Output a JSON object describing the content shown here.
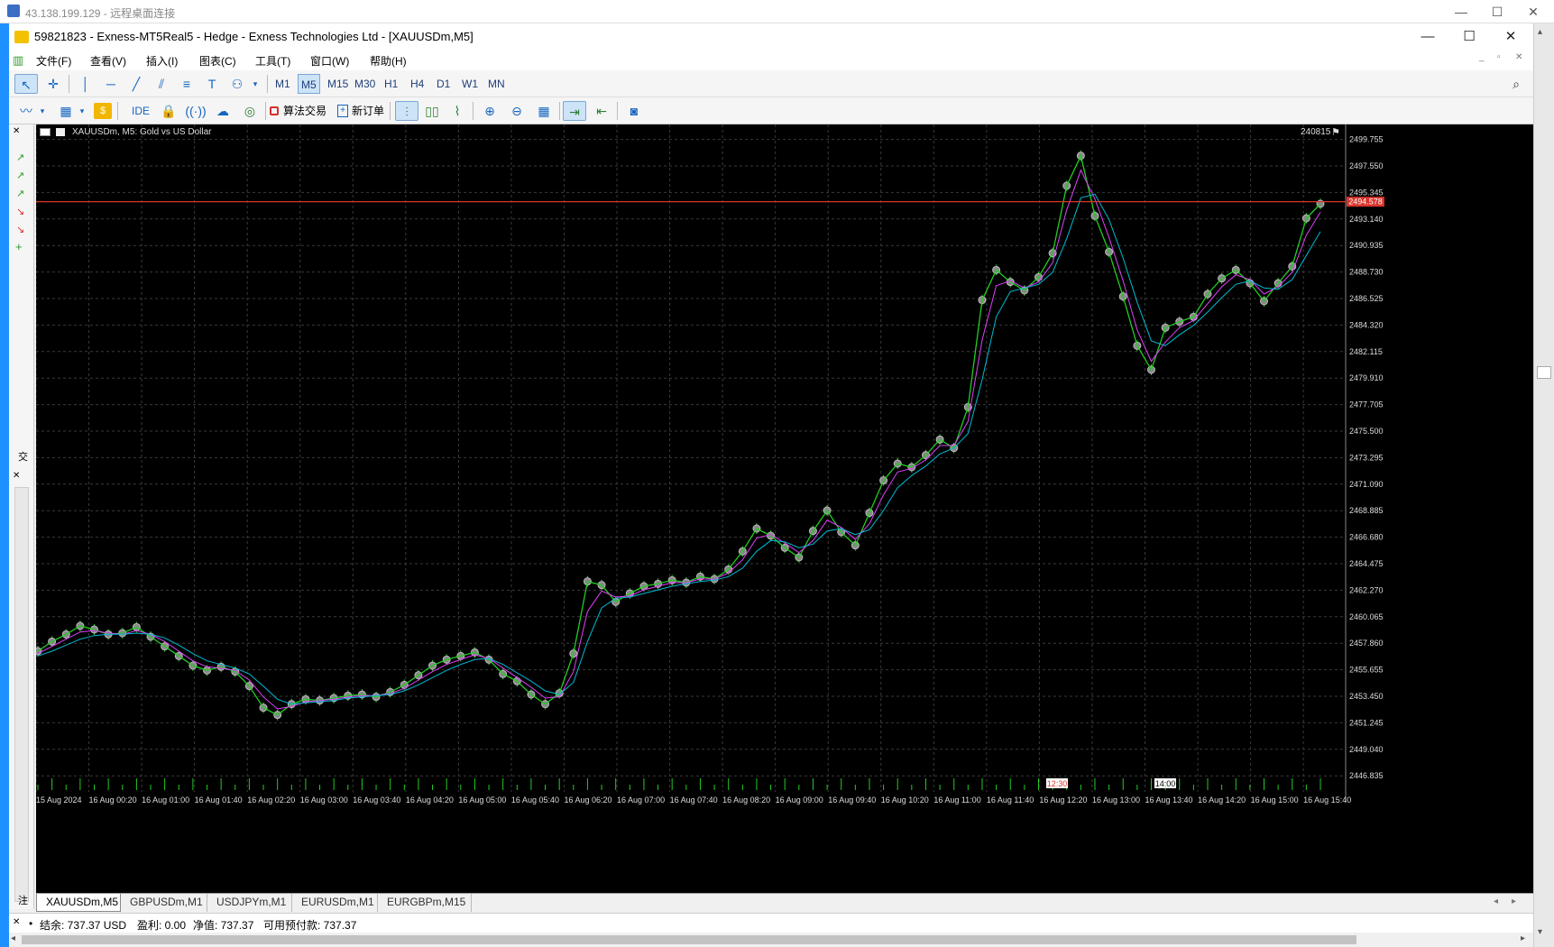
{
  "rdp": {
    "title": "43.138.199.129 - 远程桌面连接",
    "min": "—",
    "max": "☐",
    "close": "✕"
  },
  "app": {
    "title": "59821823 - Exness-MT5Real5 - Hedge - Exness Technologies Ltd - [XAUUSDm,M5]",
    "min": "—",
    "max": "☐",
    "close": "✕"
  },
  "menu": [
    "文件(F)",
    "查看(V)",
    "插入(I)",
    "图表(C)",
    "工具(T)",
    "窗口(W)",
    "帮助(H)"
  ],
  "timeframes": [
    "M1",
    "M5",
    "M15",
    "M30",
    "H1",
    "H4",
    "D1",
    "W1",
    "MN"
  ],
  "active_timeframe": "M5",
  "toolbar2": {
    "ide": "IDE",
    "algo": "算法交易",
    "new_order": "新订单"
  },
  "chart": {
    "header": "XAUUSDm, M5:  Gold vs US Dollar",
    "date_label": "240815",
    "price_tag": "2494.578",
    "time_marker_1": "12:30",
    "time_marker_2": "14:00",
    "bg_color": "#000000",
    "grid_color": "#3a3a3a",
    "price_line_color": "#d9342b",
    "candle_color": "#22cc22"
  },
  "chart_data": {
    "type": "line",
    "symbol": "XAUUSDm",
    "timeframe": "M5",
    "y_ticks": [
      "2499.755",
      "2497.550",
      "2495.345",
      "2493.140",
      "2490.935",
      "2488.730",
      "2486.525",
      "2484.320",
      "2482.115",
      "2479.910",
      "2477.705",
      "2475.500",
      "2473.295",
      "2471.090",
      "2468.885",
      "2466.680",
      "2464.475",
      "2462.270",
      "2460.065",
      "2457.860",
      "2455.655",
      "2453.450",
      "2451.245",
      "2449.040",
      "2446.835"
    ],
    "ylim": [
      2445.5,
      2501.0
    ],
    "x_ticks": [
      "15 Aug 2024",
      "16 Aug 00:20",
      "16 Aug 01:00",
      "16 Aug 01:40",
      "16 Aug 02:20",
      "16 Aug 03:00",
      "16 Aug 03:40",
      "16 Aug 04:20",
      "16 Aug 05:00",
      "16 Aug 05:40",
      "16 Aug 06:20",
      "16 Aug 07:00",
      "16 Aug 07:40",
      "16 Aug 08:20",
      "16 Aug 09:00",
      "16 Aug 09:40",
      "16 Aug 10:20",
      "16 Aug 11:00",
      "16 Aug 11:40",
      "16 Aug 12:20",
      "16 Aug 13:00",
      "16 Aug 13:40",
      "16 Aug 14:20",
      "16 Aug 15:00",
      "16 Aug 15:40"
    ],
    "current_price": 2494.578,
    "series": [
      {
        "color": "#22cc22",
        "values": [
          2457.2,
          2458.0,
          2458.6,
          2459.3,
          2459.0,
          2458.6,
          2458.7,
          2459.2,
          2458.4,
          2457.6,
          2456.8,
          2456.0,
          2455.6,
          2455.9,
          2455.5,
          2454.3,
          2452.5,
          2451.9,
          2452.8,
          2453.2,
          2453.1,
          2453.3,
          2453.5,
          2453.6,
          2453.4,
          2453.8,
          2454.4,
          2455.2,
          2456.0,
          2456.5,
          2456.8,
          2457.1,
          2456.5,
          2455.3,
          2454.7,
          2453.6,
          2452.8,
          2453.7,
          2457.0,
          2463.0,
          2462.7,
          2461.3,
          2462.0,
          2462.6,
          2462.8,
          2463.1,
          2462.9,
          2463.4,
          2463.2,
          2464.0,
          2465.5,
          2467.4,
          2466.8,
          2465.8,
          2465.0,
          2467.2,
          2468.9,
          2467.1,
          2466.0,
          2468.7,
          2471.4,
          2472.8,
          2472.5,
          2473.5,
          2474.8,
          2474.1,
          2477.5,
          2486.4,
          2488.9,
          2487.9,
          2487.2,
          2488.3,
          2490.3,
          2495.9,
          2498.4,
          2493.4,
          2490.4,
          2486.7,
          2482.6,
          2480.6,
          2484.1,
          2484.6,
          2485.0,
          2486.9,
          2488.2,
          2488.9,
          2487.8,
          2486.3,
          2487.8,
          2489.2,
          2493.2,
          2494.4
        ]
      },
      {
        "color": "#e040fb",
        "values": [
          2457.0,
          2457.6,
          2458.2,
          2458.8,
          2458.9,
          2458.7,
          2458.6,
          2458.9,
          2458.6,
          2458.0,
          2457.2,
          2456.4,
          2455.9,
          2455.8,
          2455.6,
          2454.8,
          2453.4,
          2452.4,
          2452.6,
          2453.0,
          2453.1,
          2453.2,
          2453.4,
          2453.5,
          2453.5,
          2453.7,
          2454.1,
          2454.8,
          2455.5,
          2456.1,
          2456.5,
          2456.9,
          2456.6,
          2455.8,
          2455.0,
          2454.2,
          2453.3,
          2453.4,
          2455.5,
          2460.5,
          2462.2,
          2461.7,
          2461.8,
          2462.3,
          2462.6,
          2462.9,
          2462.9,
          2463.2,
          2463.2,
          2463.7,
          2464.8,
          2466.6,
          2466.9,
          2466.2,
          2465.4,
          2466.4,
          2468.1,
          2467.5,
          2466.5,
          2467.8,
          2470.2,
          2472.1,
          2472.4,
          2473.1,
          2474.3,
          2474.3,
          2476.3,
          2483.1,
          2487.6,
          2488.0,
          2487.4,
          2487.9,
          2489.5,
          2493.9,
          2497.2,
          2494.8,
          2491.6,
          2488.0,
          2483.9,
          2481.3,
          2482.9,
          2484.1,
          2484.7,
          2486.1,
          2487.5,
          2488.5,
          2488.1,
          2486.9,
          2487.5,
          2488.7,
          2491.8,
          2493.7
        ]
      },
      {
        "color": "#00bcd4",
        "values": [
          2456.8,
          2457.2,
          2457.7,
          2458.2,
          2458.5,
          2458.6,
          2458.6,
          2458.7,
          2458.6,
          2458.3,
          2457.7,
          2457.0,
          2456.4,
          2456.1,
          2455.8,
          2455.3,
          2454.3,
          2453.2,
          2452.8,
          2452.9,
          2453.0,
          2453.1,
          2453.3,
          2453.4,
          2453.5,
          2453.6,
          2453.9,
          2454.4,
          2455.0,
          2455.6,
          2456.1,
          2456.5,
          2456.6,
          2456.1,
          2455.4,
          2454.7,
          2453.9,
          2453.6,
          2454.6,
          2458.0,
          2460.8,
          2461.6,
          2461.7,
          2462.0,
          2462.3,
          2462.6,
          2462.8,
          2463.0,
          2463.1,
          2463.4,
          2464.1,
          2465.5,
          2466.4,
          2466.3,
          2465.8,
          2466.1,
          2467.2,
          2467.4,
          2466.9,
          2467.3,
          2468.9,
          2470.8,
          2471.8,
          2472.6,
          2473.6,
          2474.1,
          2475.3,
          2479.8,
          2485.0,
          2487.1,
          2487.4,
          2487.7,
          2488.7,
          2491.5,
          2494.9,
          2495.2,
          2493.1,
          2489.9,
          2486.2,
          2483.0,
          2482.6,
          2483.5,
          2484.3,
          2485.4,
          2486.6,
          2487.7,
          2488.0,
          2487.4,
          2487.3,
          2488.1,
          2490.1,
          2492.1
        ]
      }
    ]
  },
  "tabs": [
    "XAUUSDm,M5",
    "GBPUSDm,M1",
    "USDJPYm,M1",
    "EURUSDm,M1",
    "EURGBPm,M15"
  ],
  "status": {
    "balance": "结余: 737.37 USD",
    "profit": "盈利: 0.00",
    "equity": "净值: 737.37",
    "free_margin": "可用预付款: 737.37"
  },
  "nav_labels": {
    "top": "交",
    "bottom": "注"
  }
}
